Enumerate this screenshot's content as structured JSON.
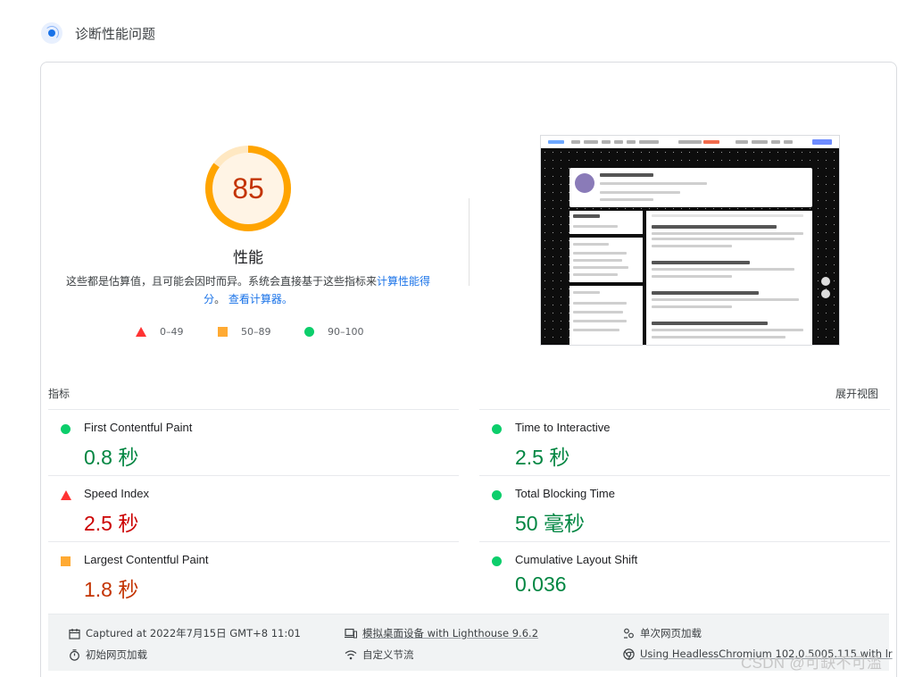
{
  "header": {
    "title": "诊断性能问题"
  },
  "gauge": {
    "score": "85",
    "score_value": 85,
    "label": "性能",
    "color": "#ffa400",
    "text_color": "#c33300"
  },
  "description": {
    "text": "这些都是估算值，且可能会因时而异。系统会直接基于这些指标来",
    "link1": "计算性能得分",
    "sep": "。",
    "link2": "查看计算器。"
  },
  "legend": [
    {
      "range": "0–49",
      "shape": "triangle",
      "color": "#ff3333"
    },
    {
      "range": "50–89",
      "shape": "square",
      "color": "#ffaa33"
    },
    {
      "range": "90–100",
      "shape": "circle",
      "color": "#0cce6b"
    }
  ],
  "metrics_section": {
    "title": "指标",
    "expand": "展开视图"
  },
  "metrics": [
    {
      "name": "First Contentful Paint",
      "value": "0.8 秒",
      "status": "pass"
    },
    {
      "name": "Time to Interactive",
      "value": "2.5 秒",
      "status": "pass"
    },
    {
      "name": "Speed Index",
      "value": "2.5 秒",
      "status": "fail"
    },
    {
      "name": "Total Blocking Time",
      "value": "50 毫秒",
      "status": "pass"
    },
    {
      "name": "Largest Contentful Paint",
      "value": "1.8 秒",
      "status": "average"
    },
    {
      "name": "Cumulative Layout Shift",
      "value": "0.036",
      "status": "pass"
    }
  ],
  "footer": {
    "captured": "Captured at 2022年7月15日 GMT+8 11:01",
    "device": "模拟桌面设备 with Lighthouse 9.6.2",
    "session": "单次网页加载",
    "initial_load": "初始网页加载",
    "throttling": "自定义节流",
    "browser": "Using HeadlessChromium 102.0.5005.115 with lr"
  },
  "watermark": "CSDN @可缺不可滥",
  "icons": {
    "header": "lighthouse-icon",
    "captured": "calendar-icon",
    "device": "devices-icon",
    "session": "user-icon",
    "initial_load": "timer-icon",
    "throttling": "wifi-icon",
    "browser": "chrome-icon"
  }
}
